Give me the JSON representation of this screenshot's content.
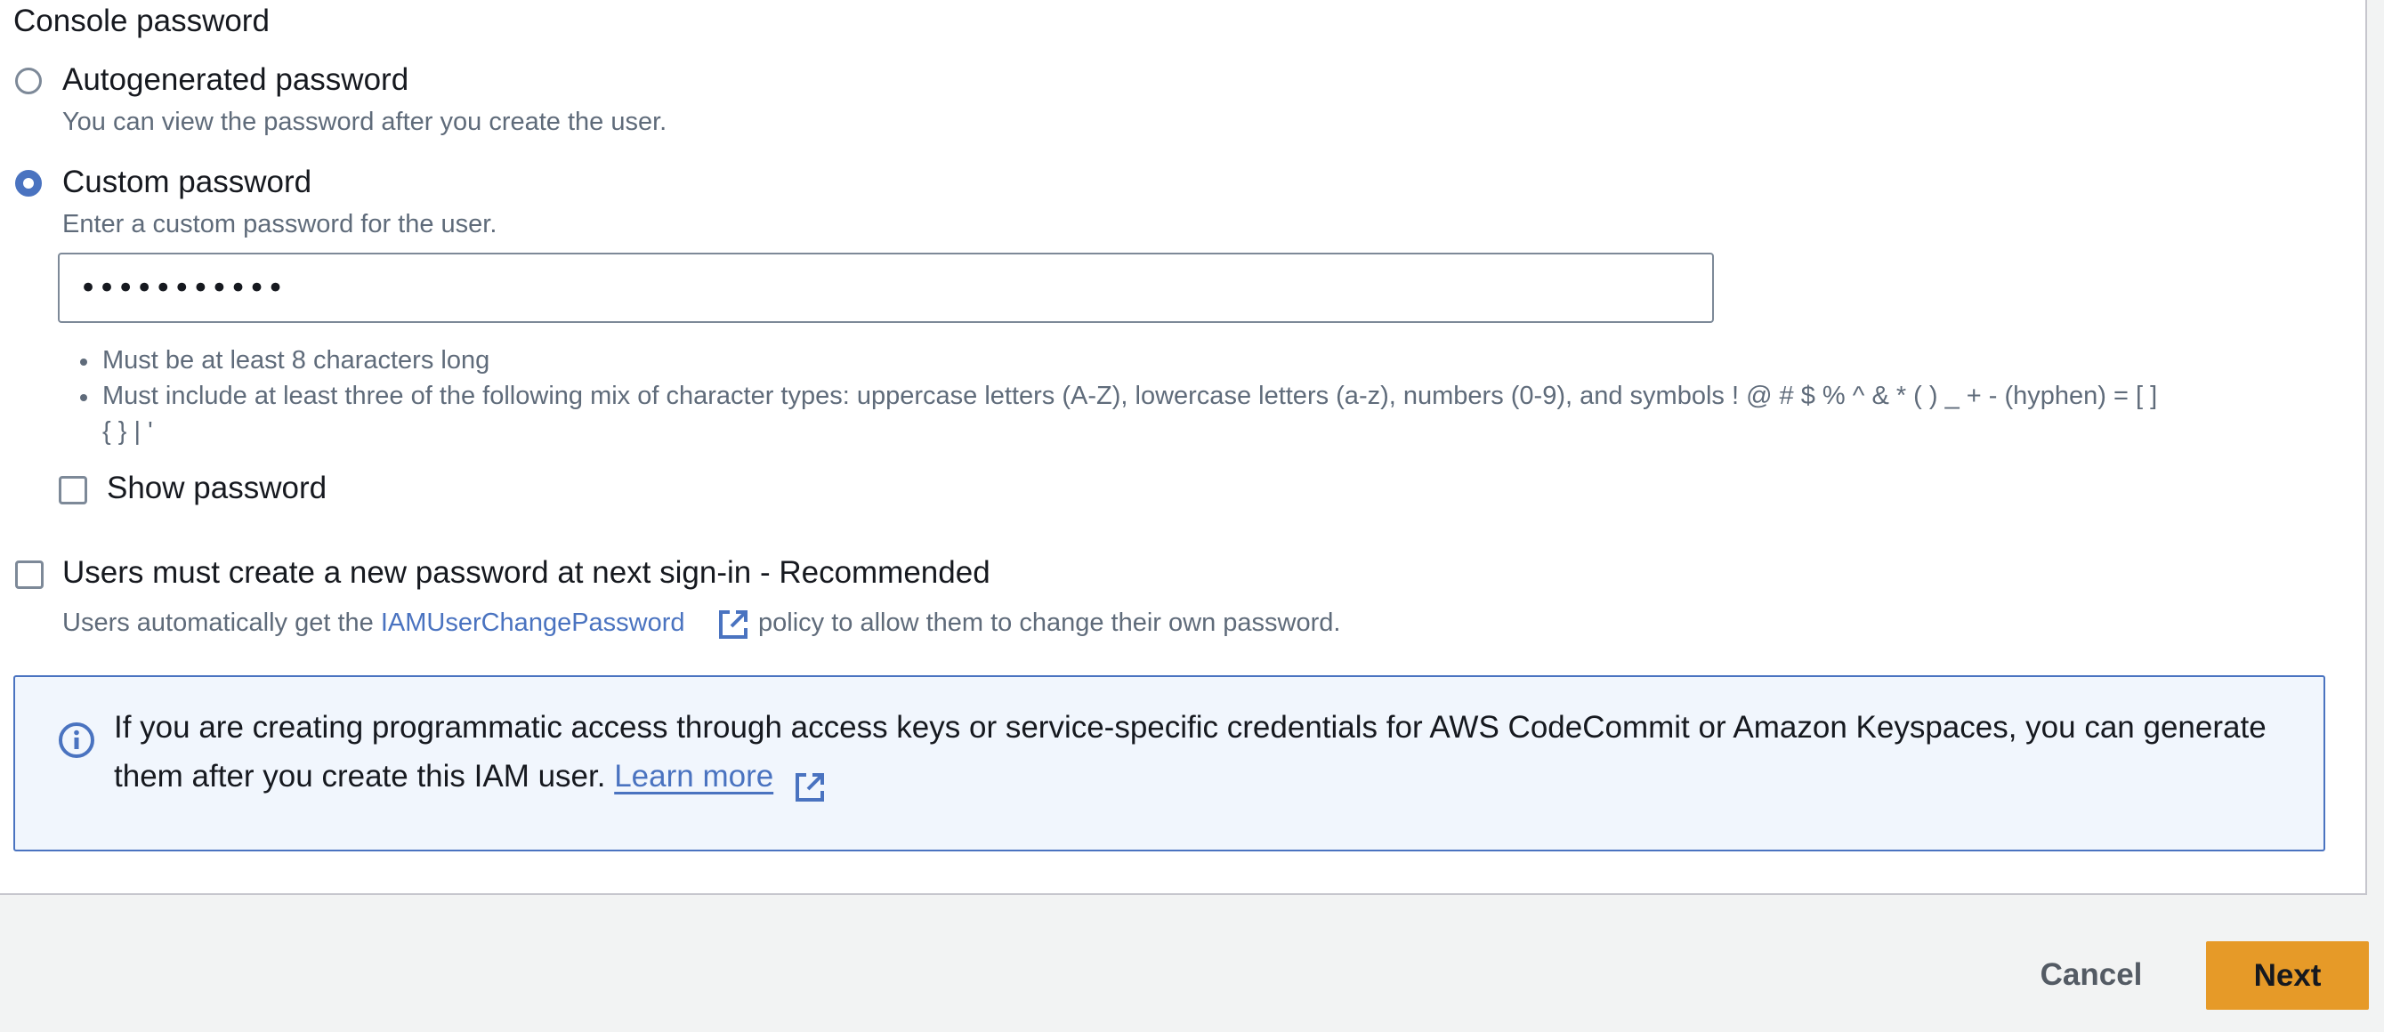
{
  "section": {
    "title": "Console password"
  },
  "options": {
    "autogenerated": {
      "label": "Autogenerated password",
      "description": "You can view the password after you create the user.",
      "selected": false
    },
    "custom": {
      "label": "Custom password",
      "description": "Enter a custom password for the user.",
      "selected": true
    }
  },
  "password_field": {
    "value": "•••••••••••"
  },
  "requirements": [
    "Must be at least 8 characters long",
    "Must include at least three of the following mix of character types: uppercase letters (A-Z), lowercase letters (a-z), numbers (0-9), and symbols ! @ # $ % ^ & * ( ) _ + - (hyphen) = [ ]",
    "{ } | '"
  ],
  "show_password": {
    "label": "Show password",
    "checked": false
  },
  "reset_required": {
    "label": "Users must create a new password at next sign-in - Recommended",
    "checked": false,
    "desc_prefix": "Users automatically get the ",
    "policy_link": "IAMUserChangePassword",
    "desc_suffix": " policy to allow them to change their own password."
  },
  "info_alert": {
    "line1": "If you are creating programmatic access through access keys or service-specific credentials for AWS CodeCommit or Amazon Keyspaces, you can generate",
    "line2": "them after you create this IAM user.",
    "link": "Learn more"
  },
  "footer": {
    "cancel_label": "Cancel",
    "next_label": "Next"
  },
  "colors": {
    "primary_link": "#4a73c0",
    "next_button": "#e69a28",
    "info_bg": "#f1f6fd"
  },
  "icons": {
    "external_link": "external-link-icon",
    "info": "info-icon"
  }
}
